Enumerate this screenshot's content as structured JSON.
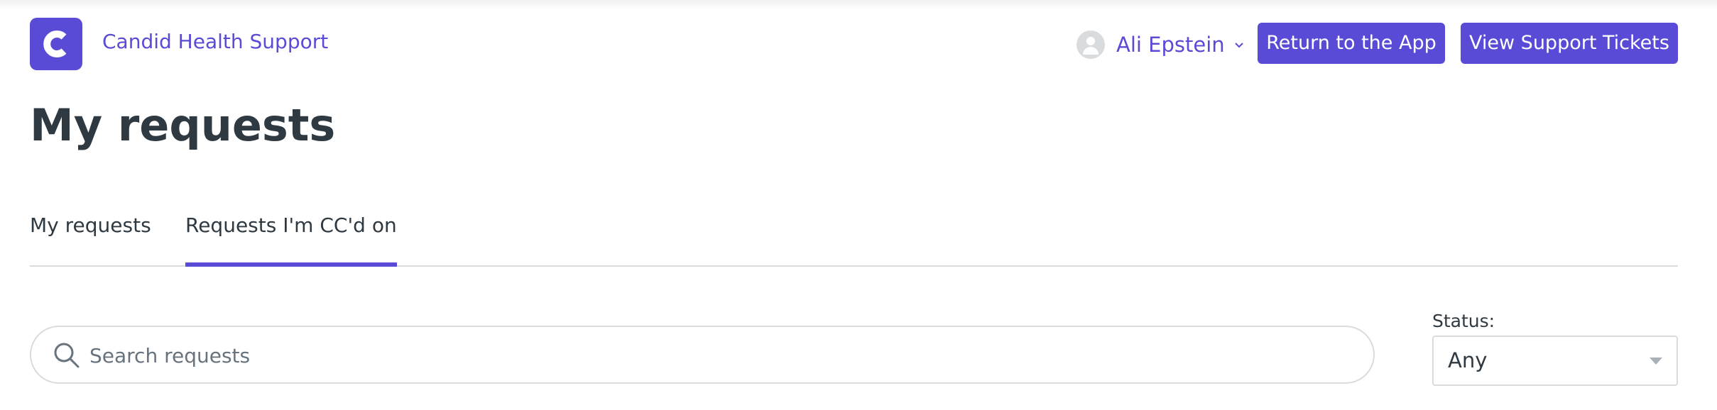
{
  "header": {
    "brand": "Candid Health Support",
    "logo_letter": "C",
    "user_name": "Ali Epstein",
    "return_button": "Return to the App",
    "tickets_button": "View Support Tickets"
  },
  "page": {
    "title": "My requests"
  },
  "tabs": [
    {
      "label": "My requests",
      "active": false
    },
    {
      "label": "Requests I'm CC'd on",
      "active": true
    }
  ],
  "search": {
    "placeholder": "Search requests",
    "value": ""
  },
  "status_filter": {
    "label": "Status:",
    "selected": "Any"
  },
  "colors": {
    "accent": "#5a4bd6",
    "text": "#2f3941",
    "border": "#d8dcde"
  },
  "icons": [
    "logo-icon",
    "avatar-icon",
    "chevron-down-icon",
    "search-icon",
    "caret-down-icon"
  ]
}
